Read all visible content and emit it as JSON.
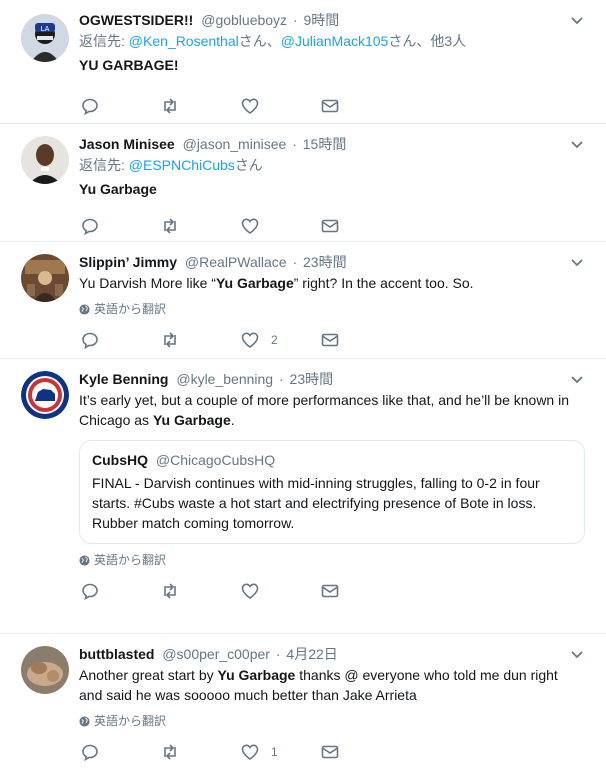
{
  "ui": {
    "reply_prefix": "返信先:",
    "translate_label": "英語から翻訳",
    "san": "さん",
    "joiner": "、"
  },
  "tweets": [
    {
      "name": "OGWESTSIDER!!",
      "handle": "@goblueboyz",
      "time": "9時間",
      "reply_users": [
        "@Ken_Rosenthal",
        "@JulianMack105"
      ],
      "reply_suffix": "さん、他3人",
      "text": "YU GARBAGE!",
      "likes": ""
    },
    {
      "name": "Jason Minisee",
      "handle": "@jason_minisee",
      "time": "15時間",
      "reply_users": [
        "@ESPNChiCubs"
      ],
      "reply_suffix": "さん",
      "text": "Yu Garbage",
      "likes": ""
    },
    {
      "name": "Slippin’ Jimmy",
      "handle": "@RealPWallace",
      "time": "23時間",
      "text_parts": [
        "Yu Darvish More like “",
        "Yu Garbage",
        "” right? In the accent too. So."
      ],
      "likes": "2"
    },
    {
      "name": "Kyle Benning",
      "handle": "@kyle_benning",
      "time": "23時間",
      "text_parts": [
        "It’s early yet, but a couple of more performances like that, and he’ll be known in Chicago as ",
        "Yu Garbage",
        "."
      ],
      "quote": {
        "name": "CubsHQ",
        "handle": "@ChicagoCubsHQ",
        "text": "FINAL - Darvish continues with mid-inning struggles, falling to 0-2 in four starts. #Cubs waste a hot start and electrifying presence of Bote in loss. Rubber match coming tomorrow."
      },
      "likes": ""
    },
    {
      "name": "buttblasted",
      "handle": "@s00per_c00per",
      "time": "4月22日",
      "text_parts": [
        "Another great start by ",
        "Yu Garbage",
        " thanks @ everyone who told me dun right and said he was sooooo much better than Jake Arrieta"
      ],
      "likes": "1"
    }
  ]
}
